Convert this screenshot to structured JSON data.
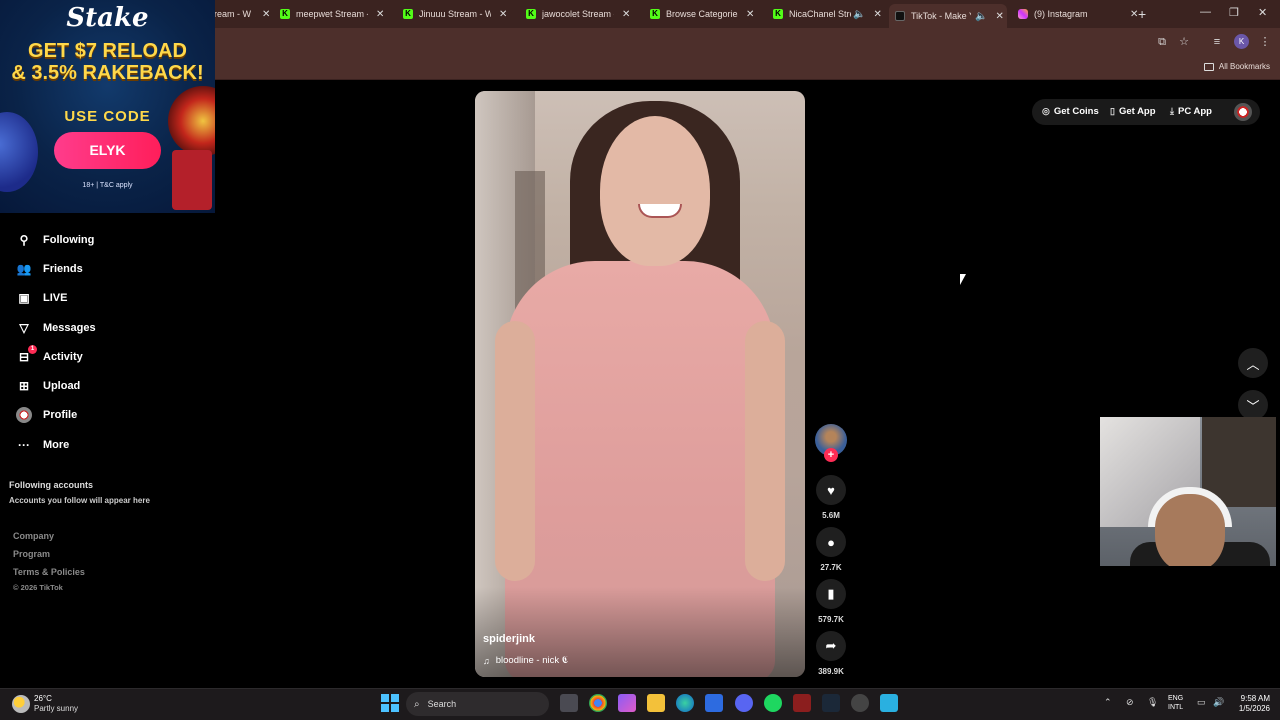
{
  "browser": {
    "tabs": [
      {
        "title": "ream - W",
        "icon": "kick-icon"
      },
      {
        "title": "meepwet Stream - W",
        "icon": "kick-icon"
      },
      {
        "title": "Jinuuu Stream - Wat",
        "icon": "kick-icon"
      },
      {
        "title": "jawocolet Stream - W",
        "icon": "kick-icon"
      },
      {
        "title": "Browse Categories - ",
        "icon": "kick-icon"
      },
      {
        "title": "NicaChanel Strea",
        "icon": "kick-icon"
      },
      {
        "title": "TikTok - Make Yo",
        "icon": "tiktok-icon",
        "active": true
      },
      {
        "title": "(9) Instagram",
        "icon": "instagram-icon"
      }
    ],
    "new_tab": "+",
    "all_bookmarks": "All Bookmarks",
    "profile_initial": "K"
  },
  "ad": {
    "brand": "Stake",
    "headline_line1": "GET $7 RELOAD",
    "headline_line2": "& 3.5% RAKEBACK!",
    "use_code": "USE CODE",
    "code": "ELYK",
    "terms": "18+ | T&C apply"
  },
  "sidebar": {
    "items": [
      {
        "label": "Following",
        "icon": "following-icon"
      },
      {
        "label": "Friends",
        "icon": "friends-icon"
      },
      {
        "label": "LIVE",
        "icon": "live-icon"
      },
      {
        "label": "Messages",
        "icon": "messages-icon"
      },
      {
        "label": "Activity",
        "icon": "activity-icon",
        "badge": "1"
      },
      {
        "label": "Upload",
        "icon": "upload-icon"
      },
      {
        "label": "Profile",
        "icon": "profile-avatar"
      },
      {
        "label": "More",
        "icon": "more-icon"
      }
    ],
    "following_accounts_title": "Following accounts",
    "following_accounts_hint": "Accounts you follow will appear here",
    "footer_links": [
      "Company",
      "Program",
      "Terms & Policies"
    ],
    "copyright": "© 2026 TikTok"
  },
  "topbar": {
    "get_coins": "Get Coins",
    "get_app": "Get App",
    "pc_app": "PC App"
  },
  "video": {
    "username": "spiderjink",
    "sound": "bloodline - nick 𝕮"
  },
  "actions": {
    "likes": "5.6M",
    "comments": "27.7K",
    "saves": "579.7K",
    "shares": "389.9K"
  },
  "taskbar": {
    "temperature": "26°C",
    "weather": "Partly sunny",
    "search_placeholder": "Search",
    "lang_line1": "ENG",
    "lang_line2": "INTL",
    "time": "9:58 AM",
    "date": "1/5/2026"
  },
  "colors": {
    "accent": "#fe2c55",
    "chrome_bg": "#4d2f2b",
    "ad_yellow": "#ffd84a"
  }
}
